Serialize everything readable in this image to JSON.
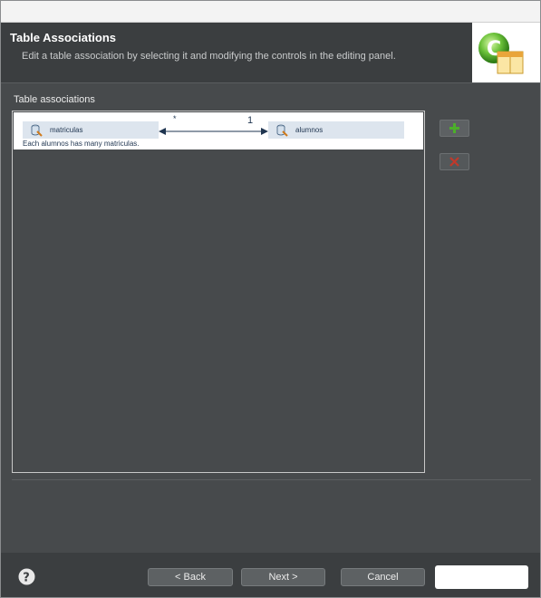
{
  "header": {
    "title": "Table Associations",
    "description": "Edit a table association by selecting it and modifying the controls in the editing panel."
  },
  "section": {
    "label": "Table associations"
  },
  "associations": [
    {
      "source_table": "matriculas",
      "target_table": "alumnos",
      "source_cardinality": "*",
      "target_cardinality": "1",
      "description": "Each alumnos has many matriculas."
    }
  ],
  "side_buttons": {
    "add_icon": "plus-icon",
    "remove_icon": "delete-x-icon"
  },
  "footer": {
    "help_icon": "help-icon",
    "back_label": "< Back",
    "next_label": "Next >",
    "cancel_label": "Cancel",
    "finish_label": ""
  },
  "colors": {
    "dialog_bg": "#474a4c",
    "header_bg": "#3b3e40",
    "table_box": "#dde5ee",
    "add_green": "#4caf2a",
    "remove_red": "#c0392b"
  }
}
